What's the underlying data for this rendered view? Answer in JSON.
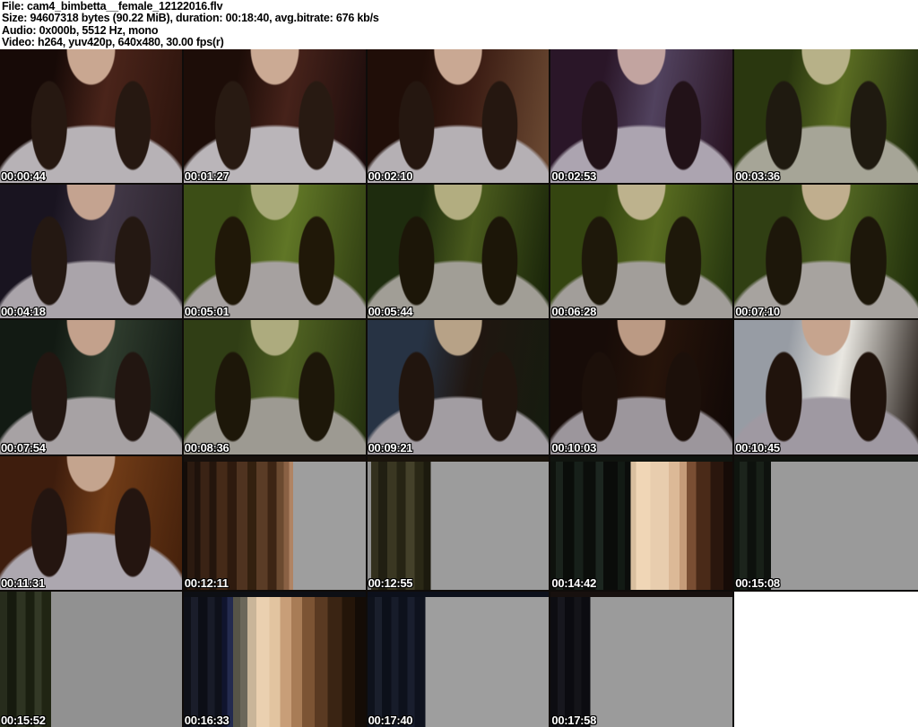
{
  "header": {
    "lines": [
      "File: cam4_bimbetta__female_12122016.flv",
      "Size: 94607318 bytes (90.22 MiB), duration: 00:18:40, avg.bitrate: 676 kb/s",
      "Audio: 0x000b, 5512 Hz, mono",
      "Video: h264, yuv420p, 640x480, 30.00 fps(r)"
    ]
  },
  "grid": {
    "columns": 5,
    "rows": 5,
    "separator_color": "#0f0c0a",
    "timestamp_text_color": "#ffffff"
  },
  "thumbnails": [
    {
      "timestamp": "00:00:44",
      "variant": "photo",
      "colors": {
        "bg_left": "#170a07",
        "bg_mid": "#4a241a",
        "bg_right": "#2b130c",
        "hoodie": "#b7b2b6",
        "hair": "#261811",
        "skin": "#c9a791"
      }
    },
    {
      "timestamp": "00:01:27",
      "variant": "photo",
      "colors": {
        "bg_left": "#1d0d08",
        "bg_mid": "#46221a",
        "bg_right": "#190b0b",
        "hoodie": "#bab5b9",
        "hair": "#281a12",
        "skin": "#cbaa94"
      }
    },
    {
      "timestamp": "00:02:10",
      "variant": "photo",
      "colors": {
        "bg_left": "#200e08",
        "bg_mid": "#3c1d14",
        "bg_right": "#6e4c34",
        "hoodie": "#b5b0b4",
        "hair": "#251710",
        "skin": "#c9a893"
      }
    },
    {
      "timestamp": "00:02:53",
      "variant": "photo",
      "colors": {
        "bg_left": "#2a1628",
        "bg_mid": "#51425e",
        "bg_right": "#26101e",
        "hoodie": "#aca4b0",
        "hair": "#221218",
        "skin": "#c2a4a0"
      }
    },
    {
      "timestamp": "00:03:36",
      "variant": "photo",
      "colors": {
        "bg_left": "#2a370f",
        "bg_mid": "#5a6c22",
        "bg_right": "#1a250b",
        "hoodie": "#a6a597",
        "hair": "#1f1a10",
        "skin": "#b7b188"
      }
    },
    {
      "timestamp": "00:04:18",
      "variant": "photo",
      "colors": {
        "bg_left": "#191420",
        "bg_mid": "#423847",
        "bg_right": "#282029",
        "hoodie": "#aaa4aa",
        "hair": "#241812",
        "skin": "#c4a390"
      }
    },
    {
      "timestamp": "00:05:01",
      "variant": "photo",
      "colors": {
        "bg_left": "#3c4e16",
        "bg_mid": "#607626",
        "bg_right": "#2e3c11",
        "hoodie": "#a6a1a0",
        "hair": "#201808",
        "skin": "#a9aa79"
      }
    },
    {
      "timestamp": "00:05:44",
      "variant": "photo",
      "colors": {
        "bg_left": "#1e2c0e",
        "bg_mid": "#4a5b1d",
        "bg_right": "#162108",
        "hoodie": "#a19e96",
        "hair": "#1c1608",
        "skin": "#b2ad80"
      }
    },
    {
      "timestamp": "00:06:28",
      "variant": "photo",
      "colors": {
        "bg_left": "#344510",
        "bg_mid": "#586b20",
        "bg_right": "#22320d",
        "hoodie": "#a29e9a",
        "hair": "#1e180a",
        "skin": "#bdb28d"
      }
    },
    {
      "timestamp": "00:07:10",
      "variant": "photo",
      "colors": {
        "bg_left": "#303f13",
        "bg_mid": "#516522",
        "bg_right": "#1c2a09",
        "hoodie": "#a7a39f",
        "hair": "#1d170a",
        "skin": "#c0ae8e"
      }
    },
    {
      "timestamp": "00:07:54",
      "variant": "photo",
      "colors": {
        "bg_left": "#121a13",
        "bg_mid": "#303d2e",
        "bg_right": "#0e1511",
        "hoodie": "#a7a2a4",
        "hair": "#221611",
        "skin": "#c3a18c"
      }
    },
    {
      "timestamp": "00:08:36",
      "variant": "photo",
      "colors": {
        "bg_left": "#303e15",
        "bg_mid": "#4e6021",
        "bg_right": "#24300f",
        "hoodie": "#9d9a92",
        "hair": "#1d1709",
        "skin": "#adab7e"
      }
    },
    {
      "timestamp": "00:09:21",
      "variant": "photo",
      "colors": {
        "bg_left": "#273344",
        "bg_mid": "#201610",
        "bg_right": "#151c0f",
        "hoodie": "#a29da2",
        "hair": "#21150e",
        "skin": "#b7a287"
      }
    },
    {
      "timestamp": "00:10:03",
      "variant": "photo",
      "colors": {
        "bg_left": "#170c08",
        "bg_mid": "#27140a",
        "bg_right": "#100806",
        "hoodie": "#9c969c",
        "hair": "#1c100a",
        "skin": "#bb9a84"
      }
    },
    {
      "timestamp": "00:10:45",
      "variant": "photo",
      "colors": {
        "bg_left": "#979ca4",
        "bg_mid": "#e9e7e1",
        "bg_right": "#1a120d",
        "hoodie": "#9f99a2",
        "hair": "#20130c",
        "skin": "#c6a48e"
      }
    },
    {
      "timestamp": "00:11:31",
      "variant": "photo",
      "colors": {
        "bg_left": "#3e1d0d",
        "bg_mid": "#713c17",
        "bg_right": "#44200b",
        "hoodie": "#aca7af",
        "hair": "#241510",
        "skin": "#c4a48e"
      }
    },
    {
      "timestamp": "00:12:11",
      "variant": "glitch",
      "top_strip": "#17100c",
      "stripes": [
        [
          "#140c08",
          2
        ],
        [
          "#2b1a10",
          4
        ],
        [
          "#1e120b",
          3
        ],
        [
          "#3a2315",
          5
        ],
        [
          "#24150c",
          4
        ],
        [
          "#452a18",
          6
        ],
        [
          "#2e1a0e",
          5
        ],
        [
          "#4f3320",
          6
        ],
        [
          "#33200f",
          5
        ],
        [
          "#5a3c26",
          6
        ],
        [
          "#3d2514",
          5
        ],
        [
          "#6b4a30",
          4
        ],
        [
          "#8a6144",
          3
        ],
        [
          "#b08464",
          2
        ],
        [
          "#9e9e9e",
          40
        ]
      ]
    },
    {
      "timestamp": "00:12:55",
      "variant": "glitch",
      "top_strip": "#1a140c",
      "stripes": [
        [
          "#8f8f8f",
          2
        ],
        [
          "#33301e",
          4
        ],
        [
          "#211f12",
          5
        ],
        [
          "#3a3722",
          5
        ],
        [
          "#262414",
          5
        ],
        [
          "#44412a",
          5
        ],
        [
          "#2a2816",
          5
        ],
        [
          "#1c1a0e",
          4
        ],
        [
          "#9c9c9c",
          65
        ]
      ]
    },
    {
      "timestamp": "00:14:42",
      "variant": "glitch",
      "top_strip": "#10140f",
      "stripes": [
        [
          "#0e120d",
          3
        ],
        [
          "#1a231c",
          4
        ],
        [
          "#0a0d0a",
          6
        ],
        [
          "#17201a",
          5
        ],
        [
          "#0b0e0b",
          7
        ],
        [
          "#1c2620",
          4
        ],
        [
          "#0a0c0a",
          8
        ],
        [
          "#121a14",
          4
        ],
        [
          "#0b0d0b",
          3
        ],
        [
          "#d9bf9f",
          3
        ],
        [
          "#f0d6b6",
          8
        ],
        [
          "#e8cdae",
          10
        ],
        [
          "#dcb997",
          6
        ],
        [
          "#c59b79",
          4
        ],
        [
          "#7a4e33",
          5
        ],
        [
          "#4a2a18",
          8
        ],
        [
          "#2a160d",
          7
        ],
        [
          "#160b07",
          5
        ]
      ]
    },
    {
      "timestamp": "00:15:08",
      "variant": "glitch",
      "top_strip": "#10140f",
      "stripes": [
        [
          "#0f150f",
          3
        ],
        [
          "#1c241c",
          4
        ],
        [
          "#0d110d",
          5
        ],
        [
          "#182018",
          4
        ],
        [
          "#0e120e",
          4
        ],
        [
          "#9a9a9a",
          80
        ]
      ]
    },
    {
      "timestamp": "00:15:52",
      "variant": "glitch",
      "top_strip": null,
      "stripes": [
        [
          "#272c1c",
          4
        ],
        [
          "#161a0e",
          5
        ],
        [
          "#2e3422",
          5
        ],
        [
          "#1a1f10",
          5
        ],
        [
          "#333926",
          4
        ],
        [
          "#202513",
          5
        ],
        [
          "#919191",
          72
        ]
      ]
    },
    {
      "timestamp": "00:16:33",
      "variant": "glitch",
      "top_strip": "#0d0f14",
      "stripes": [
        [
          "#0e1018",
          4
        ],
        [
          "#1a1d2a",
          4
        ],
        [
          "#0c0e16",
          5
        ],
        [
          "#181b28",
          4
        ],
        [
          "#0e101a",
          4
        ],
        [
          "#10142e",
          3
        ],
        [
          "#232a4e",
          3
        ],
        [
          "#565447",
          4
        ],
        [
          "#6b675a",
          4
        ],
        [
          "#c9b599",
          5
        ],
        [
          "#ead0b0",
          7
        ],
        [
          "#e2c4a0",
          6
        ],
        [
          "#c89e78",
          6
        ],
        [
          "#a87c56",
          6
        ],
        [
          "#7c5434",
          7
        ],
        [
          "#5a3a22",
          7
        ],
        [
          "#3a2413",
          8
        ],
        [
          "#241509",
          7
        ],
        [
          "#140c06",
          6
        ]
      ]
    },
    {
      "timestamp": "00:17:40",
      "variant": "glitch",
      "top_strip": "#0c101b",
      "stripes": [
        [
          "#0e121c",
          4
        ],
        [
          "#1a1f2c",
          4
        ],
        [
          "#0c101a",
          5
        ],
        [
          "#171c2a",
          4
        ],
        [
          "#0d111c",
          5
        ],
        [
          "#191e2e",
          4
        ],
        [
          "#0e121e",
          6
        ],
        [
          "#9e9e9e",
          68
        ]
      ]
    },
    {
      "timestamp": "00:17:58",
      "variant": "glitch",
      "top_strip": "#17100e",
      "stripes": [
        [
          "#0d0d12",
          4
        ],
        [
          "#17171e",
          4
        ],
        [
          "#0b0b10",
          5
        ],
        [
          "#141419",
          4
        ],
        [
          "#0c0c11",
          5
        ],
        [
          "#9b9b9b",
          78
        ]
      ]
    },
    {
      "variant": "blank"
    }
  ]
}
